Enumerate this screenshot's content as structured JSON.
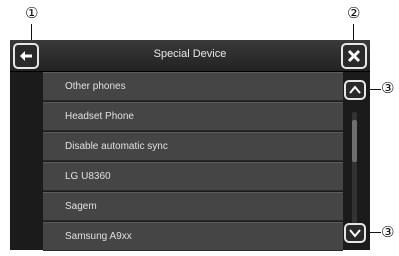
{
  "callouts": {
    "back": "①",
    "close": "②",
    "scroll_up": "③",
    "scroll_down": "③"
  },
  "header": {
    "title": "Special Device",
    "back_icon": "arrow-left-icon",
    "close_icon": "close-icon"
  },
  "list": {
    "items": [
      "Other phones",
      "Headset Phone",
      "Disable automatic sync",
      "LG U8360",
      "Sagem",
      "Samsung A9xx"
    ]
  },
  "scrollbar": {
    "up_icon": "chevron-up-icon",
    "down_icon": "chevron-down-icon"
  },
  "colors": {
    "screen_bg": "#1b1b1b",
    "item_bg": "#454545",
    "button_border": "#e6e6e6",
    "text": "#e0e0e0"
  }
}
